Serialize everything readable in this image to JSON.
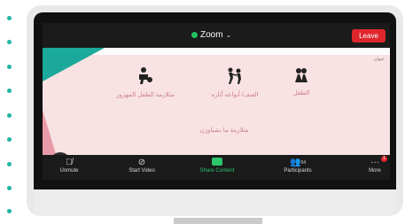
{
  "window": {
    "title": "Zoom",
    "leave_label": "Leave"
  },
  "slide": {
    "header": "عنوان",
    "topics": [
      {
        "label": "الطفل",
        "icon": "children-icon"
      },
      {
        "label": "العنف/ أنواعه آثاره",
        "icon": "violence-icon"
      },
      {
        "label": "متلازمة الطفل المهزوز",
        "icon": "shaken-baby-icon"
      },
      {
        "label": "متلازمة ما نشباوزن",
        "icon": "none"
      }
    ]
  },
  "toolbar": {
    "unmute": "Unmute",
    "start_video": "Start Video",
    "share_content": "Share Content",
    "participants": "Participants",
    "participants_count": "54",
    "more": "More",
    "more_badge": "1"
  },
  "colors": {
    "accent_green": "#2bc56b",
    "leave_red": "#e0262d",
    "slide_bg": "#f9e2e3",
    "teal": "#1aa99a"
  }
}
